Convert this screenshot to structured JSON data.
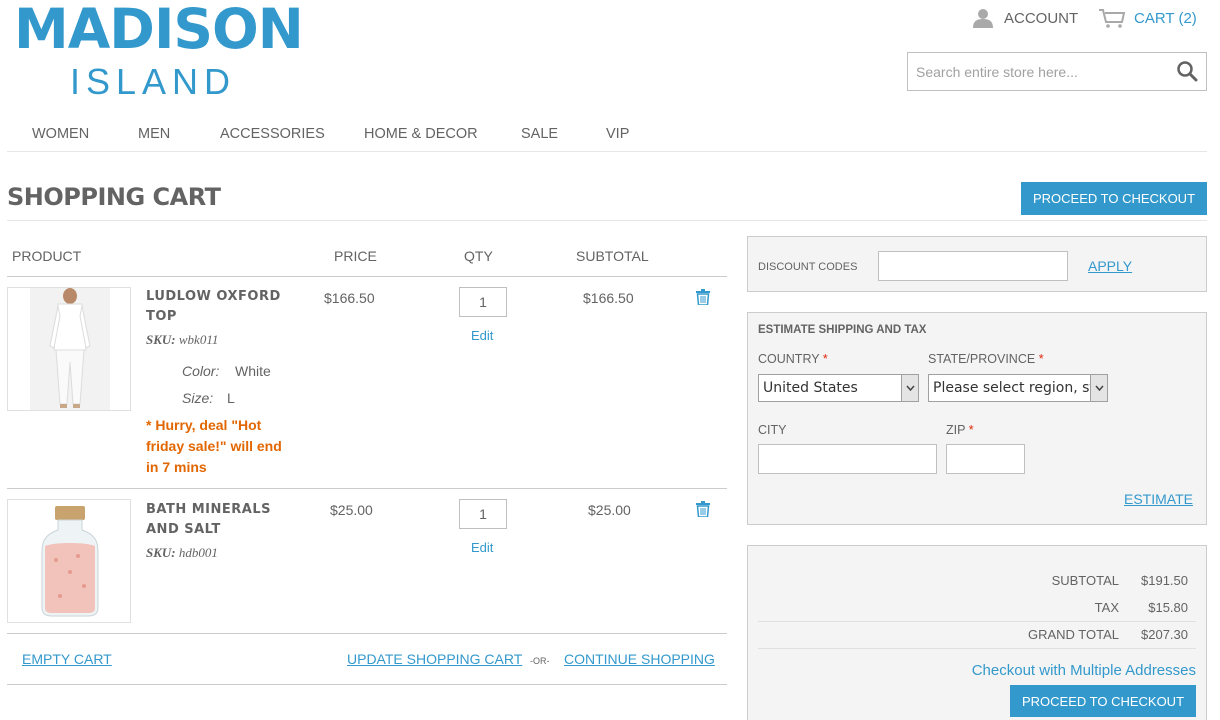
{
  "header": {
    "logo_top": "MADISON",
    "logo_bottom": "ISLAND",
    "account_label": "ACCOUNT",
    "cart_label": "CART (2)",
    "search_placeholder": "Search entire store here..."
  },
  "nav": {
    "items": [
      "WOMEN",
      "MEN",
      "ACCESSORIES",
      "HOME & DECOR",
      "SALE",
      "VIP"
    ]
  },
  "page": {
    "title": "SHOPPING CART",
    "checkout_button": "PROCEED TO CHECKOUT"
  },
  "cart": {
    "headers": [
      "PRODUCT",
      "PRICE",
      "QTY",
      "SUBTOTAL"
    ],
    "items": [
      {
        "name_line1": "LUDLOW OXFORD",
        "name_line2": "TOP",
        "sku_label": "SKU:",
        "sku": "wbk011",
        "options": [
          {
            "label": "Color:",
            "value": "White"
          },
          {
            "label": "Size:",
            "value": "L"
          }
        ],
        "hurry_line1": "* Hurry, deal \"Hot",
        "hurry_line2": "friday sale!\" will end",
        "hurry_line3": "in 7 mins",
        "price": "$166.50",
        "qty": "1",
        "edit": "Edit",
        "subtotal": "$166.50"
      },
      {
        "name_line1": "BATH MINERALS",
        "name_line2": "AND SALT",
        "sku_label": "SKU:",
        "sku": "hdb001",
        "price": "$25.00",
        "qty": "1",
        "edit": "Edit",
        "subtotal": "$25.00"
      }
    ],
    "empty_cart": "EMPTY CART",
    "update_cart": "UPDATE SHOPPING CART",
    "or": "-OR-",
    "continue_shopping": "CONTINUE SHOPPING"
  },
  "discount": {
    "label": "DISCOUNT CODES",
    "apply": "APPLY"
  },
  "shipping": {
    "title": "ESTIMATE SHIPPING AND TAX",
    "country_label": "COUNTRY",
    "country_value": "United States",
    "state_label": "STATE/PROVINCE",
    "state_value": "Please select region, state or province",
    "city_label": "CITY",
    "zip_label": "ZIP",
    "required_mark": "*",
    "estimate": "ESTIMATE"
  },
  "totals": {
    "subtotal_label": "SUBTOTAL",
    "subtotal_value": "$191.50",
    "tax_label": "TAX",
    "tax_value": "$15.80",
    "grand_label": "GRAND TOTAL",
    "grand_value": "$207.30",
    "multi_address": "Checkout with Multiple Addresses",
    "checkout_button": "PROCEED TO CHECKOUT"
  },
  "colors": {
    "brand": "#3399cc",
    "text": "#636363",
    "alert": "#e26703",
    "required": "#df280a",
    "panel_bg": "#f4f4f4"
  }
}
